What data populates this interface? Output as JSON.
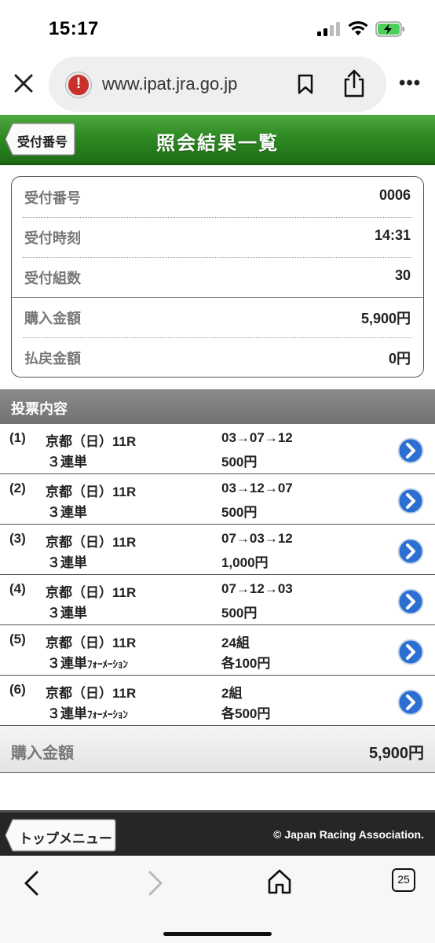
{
  "status_bar": {
    "time": "15:17"
  },
  "browser": {
    "url": "www.ipat.jra.go.jp",
    "tab_count": "25"
  },
  "header": {
    "back_label": "受付番号",
    "title": "照会結果一覧"
  },
  "summary": {
    "rows": [
      {
        "key": "受付番号",
        "value": "0006"
      },
      {
        "key": "受付時刻",
        "value": "14:31"
      },
      {
        "key": "受付組数",
        "value": "30"
      },
      {
        "key": "購入金額",
        "value": "5,900円"
      },
      {
        "key": "払戻金額",
        "value": "0円"
      }
    ]
  },
  "section": {
    "title": "投票内容"
  },
  "bets": [
    {
      "no": "(1)",
      "race": "京都（日）11R",
      "type": "３連単",
      "type_suffix": "",
      "selection": "03→07→12",
      "amount": "500円"
    },
    {
      "no": "(2)",
      "race": "京都（日）11R",
      "type": "３連単",
      "type_suffix": "",
      "selection": "03→12→07",
      "amount": "500円"
    },
    {
      "no": "(3)",
      "race": "京都（日）11R",
      "type": "３連単",
      "type_suffix": "",
      "selection": "07→03→12",
      "amount": "1,000円"
    },
    {
      "no": "(4)",
      "race": "京都（日）11R",
      "type": "３連単",
      "type_suffix": "",
      "selection": "07→12→03",
      "amount": "500円"
    },
    {
      "no": "(5)",
      "race": "京都（日）11R",
      "type": "３連単",
      "type_suffix": "ﾌｫｰﾒｰｼｮﾝ",
      "selection": "24組",
      "amount": "各100円"
    },
    {
      "no": "(6)",
      "race": "京都（日）11R",
      "type": "３連単",
      "type_suffix": "ﾌｫｰﾒｰｼｮﾝ",
      "selection": "2組",
      "amount": "各500円"
    }
  ],
  "total": {
    "label": "購入金額",
    "value": "5,900円"
  },
  "footer": {
    "top_menu_label": "トップメニュー",
    "copyright": "© Japan Racing Association."
  },
  "colors": {
    "header_green": "#2f8a23",
    "section_gray": "#7c7c7c",
    "arrow_blue": "#2a6fd1",
    "warning_red": "#c9302c"
  }
}
